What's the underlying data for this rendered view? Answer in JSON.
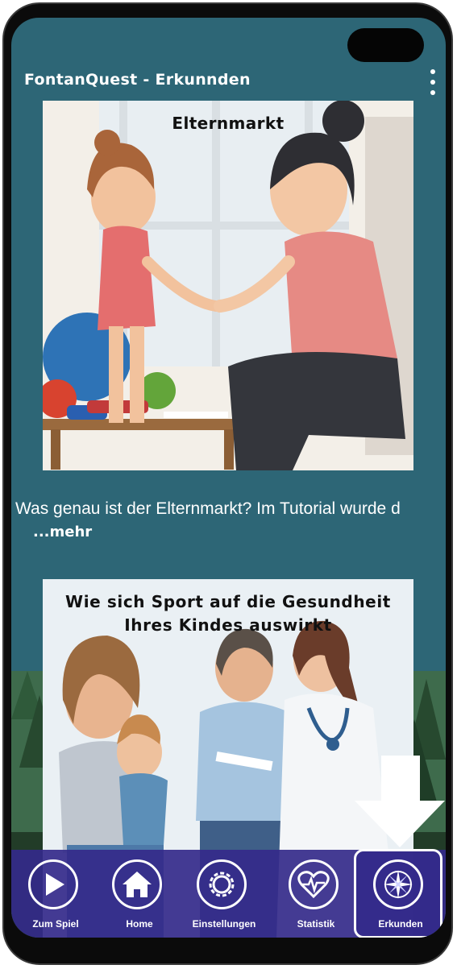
{
  "app": {
    "title": "FontanQuest - Erkunnden"
  },
  "cards": [
    {
      "title": "Elternmarkt",
      "description": "Was genau ist der Elternmarkt? Im Tutorial wurde d",
      "more_label": "...mehr"
    },
    {
      "title": "Wie sich Sport auf die Gesundheit Ihres Kindes auswirkt"
    }
  ],
  "nav": {
    "items": [
      {
        "label": "Zum Spiel",
        "icon": "play-icon"
      },
      {
        "label": "Home",
        "icon": "home-icon"
      },
      {
        "label": "Einstellungen",
        "icon": "gear-icon"
      },
      {
        "label": "Statistik",
        "icon": "heart-pulse-icon"
      },
      {
        "label": "Erkunden",
        "icon": "compass-icon"
      }
    ],
    "active": "Erkunden"
  },
  "colors": {
    "background": "#2d6676",
    "nav_bar": "#342a8a",
    "text": "#ffffff"
  }
}
